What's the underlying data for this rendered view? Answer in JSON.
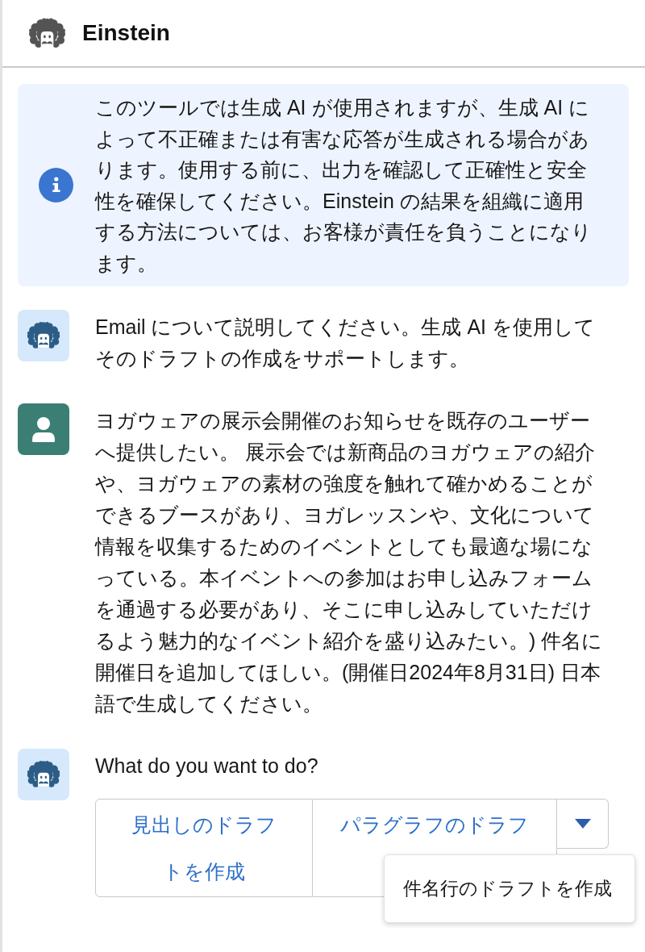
{
  "header": {
    "title": "Einstein"
  },
  "notice": {
    "text": "このツールでは生成 AI が使用されますが、生成 AI によって不正確または有害な応答が生成される場合があります。使用する前に、出力を確認して正確性と安全性を確保してください。Einstein の結果を組織に適用する方法については、お客様が責任を負うことになります。"
  },
  "messages": [
    {
      "kind": "bot",
      "text": "Email について説明してください。生成 AI を使用してそのドラフトの作成をサポートします。"
    },
    {
      "kind": "user",
      "text": "ヨガウェアの展示会開催のお知らせを既存のユーザーへ提供したい。 展示会では新商品のヨガウェアの紹介や、ヨガウェアの素材の強度を触れて確かめることができるブースがあり、ヨガレッスンや、文化について情報を収集するためのイベントとしても最適な場になっている。本イベントへの参加はお申し込みフォームを通過する必要があり、そこに申し込みしていただけるよう魅力的なイベント紹介を盛り込みたい。) 件名に開催日を追加してほしい。(開催日2024年8月31日) 日本語で生成してください。"
    },
    {
      "kind": "bot",
      "text": "What do you want to do?",
      "actions": [
        {
          "label": "見出しのドラフトを作成"
        },
        {
          "label": "パラグラフのドラフ"
        }
      ],
      "dropdown": {
        "expanded": true,
        "items": [
          {
            "label": "件名行のドラフトを作成"
          }
        ]
      }
    }
  ]
}
